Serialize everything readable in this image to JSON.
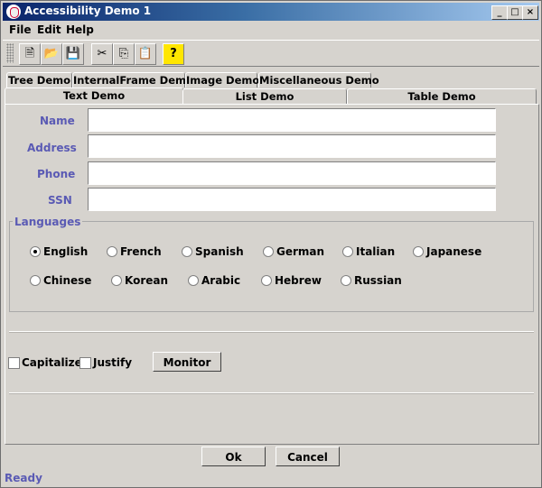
{
  "window": {
    "title": "Accessibility Demo 1"
  },
  "titlebar": {
    "min_glyph": "_",
    "max_glyph": "□",
    "close_glyph": "×"
  },
  "menu": [
    {
      "label": "File",
      "mnemonic": "F"
    },
    {
      "label": "Edit",
      "mnemonic": "E"
    },
    {
      "label": "Help",
      "mnemonic": "H"
    }
  ],
  "toolbar": {
    "icons": [
      "new-file-icon",
      "open-folder-icon",
      "save-disk-icon",
      "cut-scissors-icon",
      "copy-icon",
      "paste-icon",
      "help-icon"
    ],
    "glyphs": [
      "🗎",
      "📂",
      "💾",
      "✂",
      "⎘",
      "📋",
      "?"
    ]
  },
  "tabs": {
    "row1": [
      "Tree Demo",
      "InternalFrame Demo",
      "Image Demo",
      "Miscellaneous Demo"
    ],
    "row2": [
      "Text Demo",
      "List Demo",
      "Table Demo"
    ],
    "selected": "Text Demo"
  },
  "form": {
    "fields": [
      {
        "label": "Name",
        "value": ""
      },
      {
        "label": "Address",
        "value": ""
      },
      {
        "label": "Phone",
        "value": ""
      },
      {
        "label": "SSN",
        "value": ""
      }
    ]
  },
  "languages": {
    "title": "Languages",
    "selected": "English",
    "row1": [
      "English",
      "French",
      "Spanish",
      "German",
      "Italian",
      "Japanese"
    ],
    "row2": [
      "Chinese",
      "Korean",
      "Arabic",
      "Hebrew",
      "Russian"
    ]
  },
  "options": {
    "capitalize": {
      "label": "Capitalize",
      "checked": false
    },
    "justify": {
      "label": "Justify",
      "checked": false
    },
    "monitor": "Monitor"
  },
  "buttons": {
    "ok": "Ok",
    "cancel": "Cancel"
  },
  "status": "Ready",
  "colors": {
    "title_start": "#0a246a",
    "title_end": "#a6caf0",
    "label": "#5a5ab4",
    "face": "#d6d3ce"
  }
}
